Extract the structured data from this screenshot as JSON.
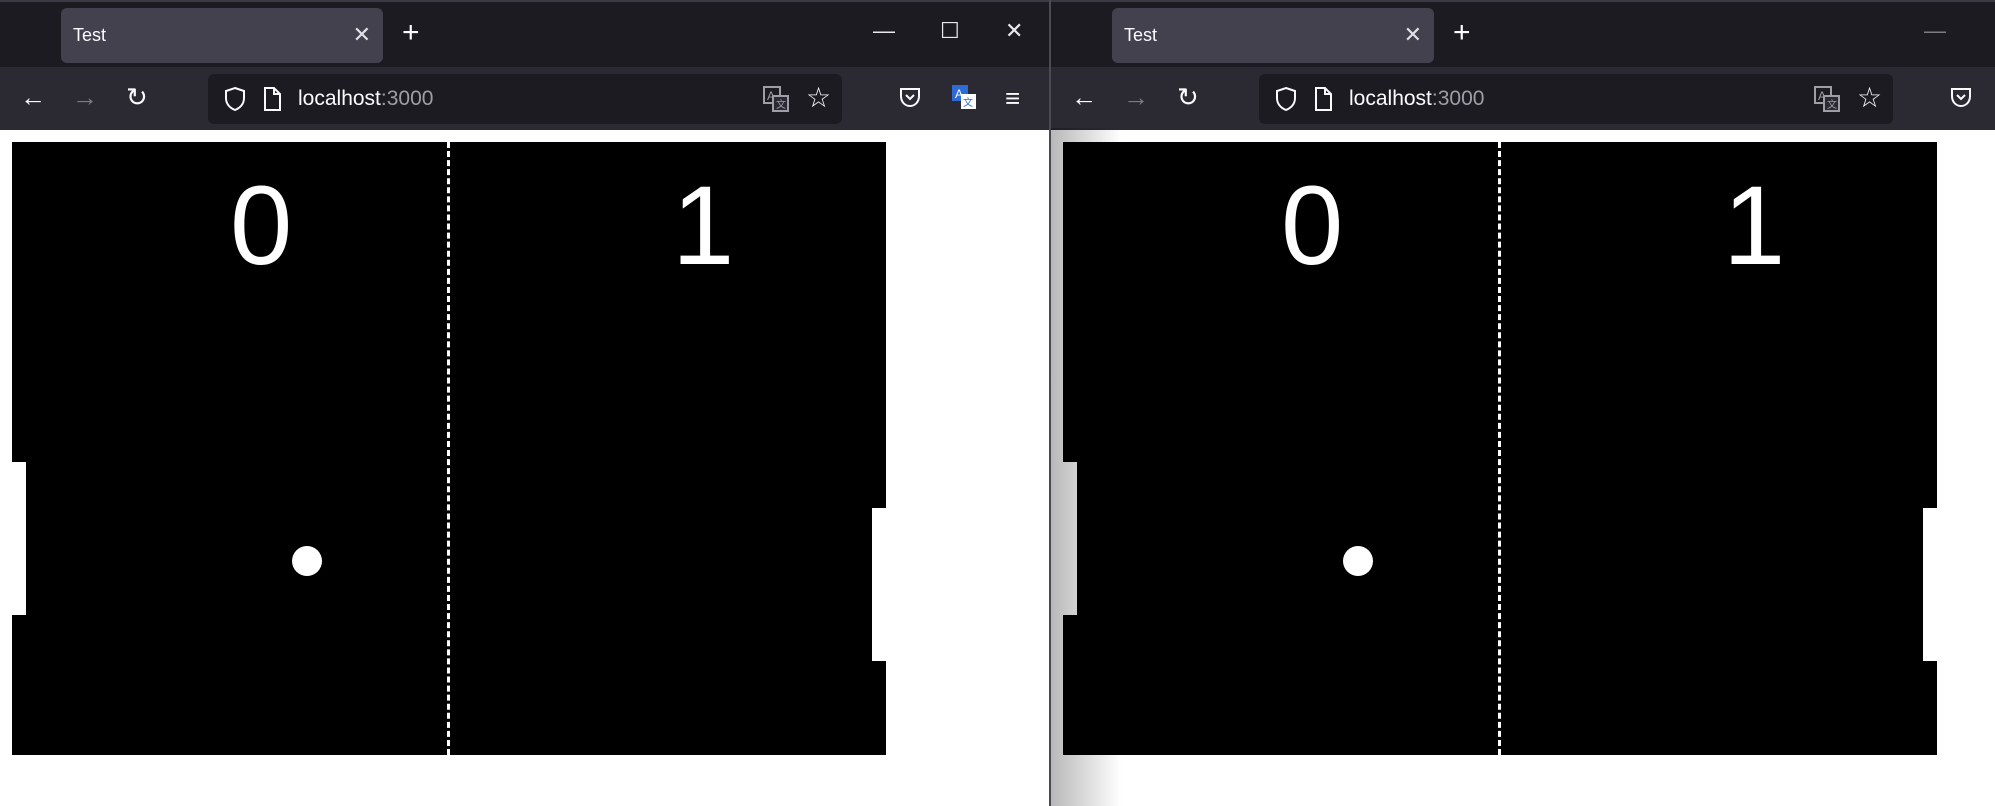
{
  "windows": [
    {
      "tab": {
        "title": "Test",
        "close": "✕"
      },
      "new_tab": "+",
      "window_controls": {
        "minimize": "—",
        "maximize": "☐",
        "close": "✕"
      },
      "nav": {
        "back": "←",
        "forward": "→",
        "reload": "↻",
        "menu": "≡"
      },
      "url": {
        "host": "localhost",
        "port": ":3000"
      },
      "game": {
        "score_left": "0",
        "score_right": "1"
      }
    },
    {
      "tab": {
        "title": "Test",
        "close": "✕"
      },
      "new_tab": "+",
      "window_controls": {
        "minimize": "—"
      },
      "nav": {
        "back": "←",
        "forward": "→",
        "reload": "↻"
      },
      "url": {
        "host": "localhost",
        "port": ":3000"
      },
      "game": {
        "score_left": "0",
        "score_right": "1"
      }
    }
  ],
  "icons": {
    "shield": "shield-icon",
    "page": "page-icon",
    "translate": "translate-icon",
    "bookmark": "star-icon",
    "pocket": "pocket-icon"
  },
  "colors": {
    "tab_bar": "#1c1b22",
    "active_tab": "#42414d",
    "nav_bar": "#2b2a33",
    "url_field": "#1c1b22",
    "game_bg": "#000000",
    "game_fg": "#ffffff",
    "translate_accent": "#2f6bd8"
  }
}
